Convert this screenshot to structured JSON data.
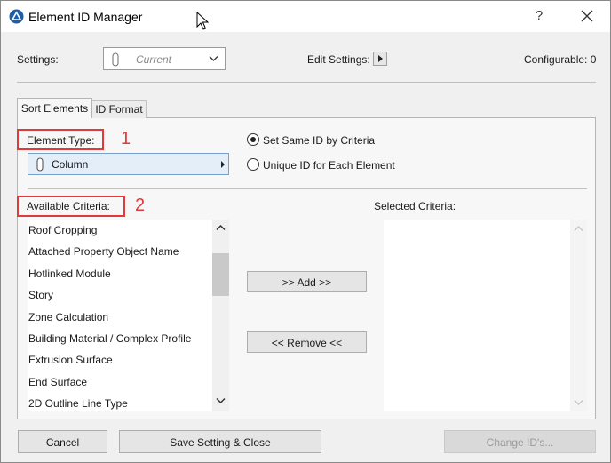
{
  "window": {
    "title": "Element ID Manager",
    "help": "?"
  },
  "settings": {
    "label": "Settings:",
    "current": "Current",
    "edit_label": "Edit Settings:",
    "configurable": "Configurable: 0"
  },
  "tabs": [
    {
      "label": "Sort Elements",
      "active": true
    },
    {
      "label": "ID Format",
      "active": false
    }
  ],
  "element_type": {
    "label": "Element Type:",
    "value": "Column",
    "callout": "1"
  },
  "radios": [
    {
      "label": "Set Same ID by Criteria",
      "checked": true
    },
    {
      "label": "Unique ID for Each Element",
      "checked": false
    }
  ],
  "available_criteria": {
    "label": "Available Criteria:",
    "callout": "2",
    "items": [
      "Roof Cropping",
      "Attached Property Object Name",
      "Hotlinked Module",
      "Story",
      "Zone Calculation",
      "Building Material / Complex Profile",
      "Extrusion Surface",
      "End Surface",
      "2D Outline Line Type"
    ]
  },
  "selected_criteria": {
    "label": "Selected Criteria:"
  },
  "buttons": {
    "add": ">> Add >>",
    "remove": "<< Remove <<",
    "cancel": "Cancel",
    "save_close": "Save Setting & Close",
    "change_ids": "Change ID's..."
  },
  "colors": {
    "callout": "#e03a3a",
    "app_icon": "#1f5fa8"
  }
}
